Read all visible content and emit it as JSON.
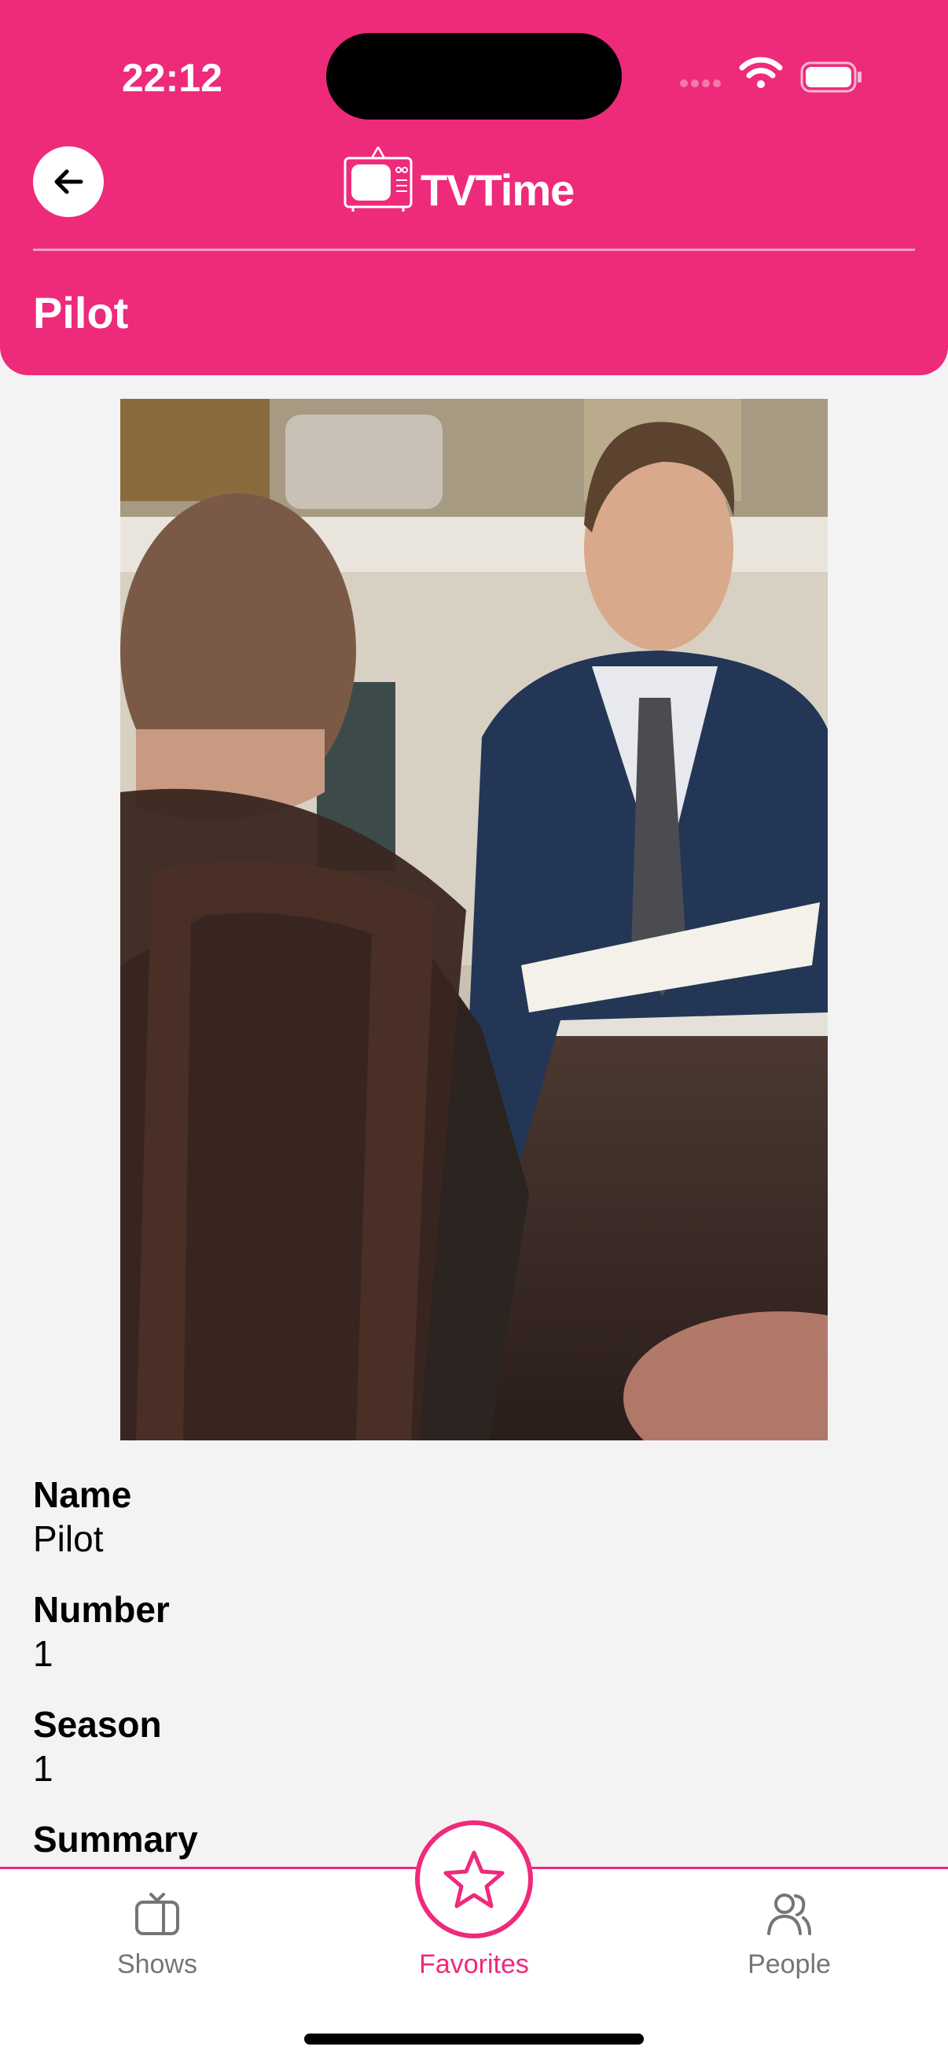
{
  "status": {
    "time": "22:12"
  },
  "header": {
    "logo_text": "TVTime",
    "title": "Pilot"
  },
  "episode": {
    "fields": [
      {
        "label": "Name",
        "value": "Pilot"
      },
      {
        "label": "Number",
        "value": "1"
      },
      {
        "label": "Season",
        "value": "1"
      }
    ],
    "summary_label": "Summary"
  },
  "tabbar": {
    "tabs": [
      {
        "label": "Shows",
        "icon": "tv-icon"
      },
      {
        "label": "Favorites",
        "icon": "star-icon"
      },
      {
        "label": "People",
        "icon": "people-icon"
      }
    ]
  },
  "colors": {
    "accent": "#ee2a7b",
    "inactive": "#757575"
  }
}
